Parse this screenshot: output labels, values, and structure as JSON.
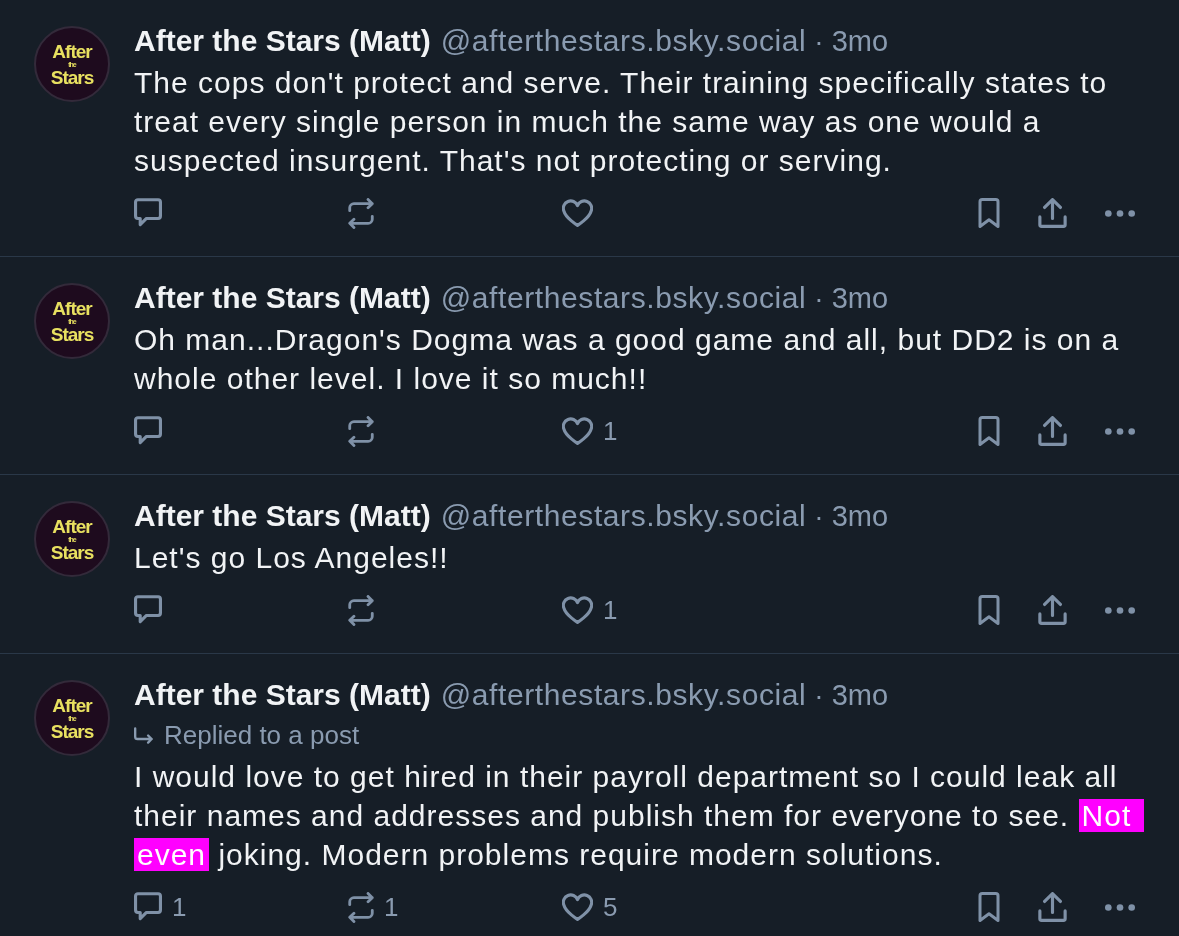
{
  "posts": [
    {
      "avatar": {
        "lines": [
          "After",
          "the",
          "Stars"
        ]
      },
      "author": "After the Stars (Matt)",
      "handle": "@afterthestars.bsky.social",
      "separator": "·",
      "time": "3mo",
      "body": [
        {
          "text": "The cops don't protect and serve. Their training specifically states to treat every single person in much the same way as one would a suspected insurgent. That's not protecting or serving.",
          "highlighted": false
        }
      ],
      "actions": [
        {
          "kind": "reply"
        },
        {
          "kind": "repost"
        },
        {
          "kind": "like"
        },
        {
          "kind": "bookmark"
        },
        {
          "kind": "share"
        },
        {
          "kind": "more"
        }
      ]
    },
    {
      "avatar": {
        "lines": [
          "After",
          "the",
          "Stars"
        ]
      },
      "author": "After the Stars (Matt)",
      "handle": "@afterthestars.bsky.social",
      "separator": "·",
      "time": "3mo",
      "body": [
        {
          "text": "Oh man...Dragon's Dogma was a good game and all, but DD2 is on a whole other level. I love it so much!!",
          "highlighted": false
        }
      ],
      "actions": [
        {
          "kind": "reply"
        },
        {
          "kind": "repost"
        },
        {
          "kind": "like",
          "count": "1"
        },
        {
          "kind": "bookmark"
        },
        {
          "kind": "share"
        },
        {
          "kind": "more"
        }
      ]
    },
    {
      "avatar": {
        "lines": [
          "After",
          "the",
          "Stars"
        ]
      },
      "author": "After the Stars (Matt)",
      "handle": "@afterthestars.bsky.social",
      "separator": "·",
      "time": "3mo",
      "body": [
        {
          "text": "Let's go Los Angeles!!",
          "highlighted": false
        }
      ],
      "actions": [
        {
          "kind": "reply"
        },
        {
          "kind": "repost"
        },
        {
          "kind": "like",
          "count": "1"
        },
        {
          "kind": "bookmark"
        },
        {
          "kind": "share"
        },
        {
          "kind": "more"
        }
      ]
    },
    {
      "avatar": {
        "lines": [
          "After",
          "the",
          "Stars"
        ]
      },
      "author": "After the Stars (Matt)",
      "handle": "@afterthestars.bsky.social",
      "separator": "·",
      "time": "3mo",
      "reply_context": "Replied to a post",
      "body": [
        {
          "text": "I would love to get hired in their payroll department so I could leak all their names and addresses and publish them for everyone to see. ",
          "highlighted": false
        },
        {
          "text": "Not even",
          "highlighted": true
        },
        {
          "text": " joking. Modern problems require modern solutions.",
          "highlighted": false
        }
      ],
      "actions": [
        {
          "kind": "reply",
          "count": "1"
        },
        {
          "kind": "repost",
          "count": "1"
        },
        {
          "kind": "like",
          "count": "5"
        },
        {
          "kind": "bookmark"
        },
        {
          "kind": "share"
        },
        {
          "kind": "more"
        }
      ]
    }
  ]
}
